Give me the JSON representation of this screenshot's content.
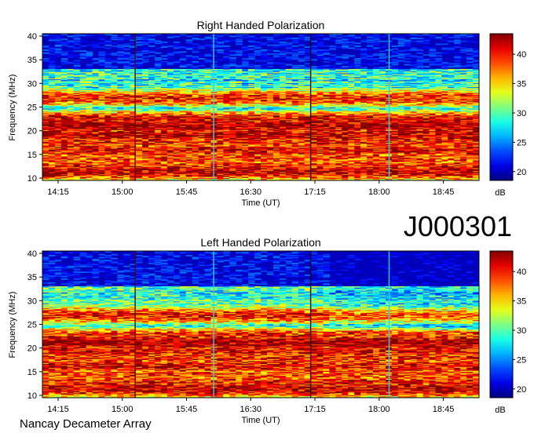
{
  "observation_id": "J000301",
  "instrument_label": "Nancay Decameter Array",
  "chart_data": [
    {
      "type": "heatmap",
      "title": "Right Handed Polarization",
      "xlabel": "Time (UT)",
      "ylabel": "Frequency (MHz)",
      "x_ticks": [
        "14:15",
        "15:00",
        "15:45",
        "16:30",
        "17:15",
        "18:00",
        "18:45"
      ],
      "x_range": [
        "14:04",
        "19:10"
      ],
      "y_ticks": [
        10,
        15,
        20,
        25,
        30,
        35,
        40
      ],
      "ylim": [
        9.5,
        40.5
      ],
      "colorbar": {
        "label": "dB",
        "ticks": [
          20,
          25,
          30,
          35,
          40
        ],
        "range": [
          18.5,
          43.5
        ],
        "colormap": "jet"
      },
      "vertical_lines": [
        {
          "time": "15:09",
          "color": "#5a0000"
        },
        {
          "time": "16:04",
          "color": "#2ad0ff"
        },
        {
          "time": "17:12",
          "color": "#1a0010"
        },
        {
          "time": "18:07",
          "color": "#2ad0ff"
        }
      ],
      "bright_bands_mhz": [
        {
          "freq": 11.5,
          "level": 42
        },
        {
          "freq": 12.6,
          "level": 40
        },
        {
          "freq": 14.2,
          "level": 39
        },
        {
          "freq": 16.0,
          "level": 41
        },
        {
          "freq": 17.8,
          "level": 40
        },
        {
          "freq": 19.2,
          "level": 42
        },
        {
          "freq": 21.2,
          "level": 43
        },
        {
          "freq": 22.5,
          "level": 41
        },
        {
          "freq": 27.0,
          "level": 40
        }
      ]
    },
    {
      "type": "heatmap",
      "title": "Left Handed Polarization",
      "xlabel": "Time (UT)",
      "ylabel": "Frequency (MHz)",
      "x_ticks": [
        "14:15",
        "15:00",
        "15:45",
        "16:30",
        "17:15",
        "18:00",
        "18:45"
      ],
      "x_range": [
        "14:04",
        "19:10"
      ],
      "y_ticks": [
        10,
        15,
        20,
        25,
        30,
        35,
        40
      ],
      "ylim": [
        9.5,
        40.5
      ],
      "colorbar": {
        "label": "dB",
        "ticks": [
          20,
          25,
          30,
          35,
          40
        ],
        "range": [
          18.5,
          43.5
        ],
        "colormap": "jet"
      },
      "vertical_lines": [
        {
          "time": "15:09",
          "color": "#5a0000"
        },
        {
          "time": "16:04",
          "color": "#2ad0ff"
        },
        {
          "time": "17:12",
          "color": "#1a0010"
        },
        {
          "time": "18:07",
          "color": "#2ad0ff"
        }
      ],
      "bright_bands_mhz": [
        {
          "freq": 11.5,
          "level": 42
        },
        {
          "freq": 12.8,
          "level": 40
        },
        {
          "freq": 14.5,
          "level": 39
        },
        {
          "freq": 16.3,
          "level": 41
        },
        {
          "freq": 18.0,
          "level": 40
        },
        {
          "freq": 19.5,
          "level": 41
        },
        {
          "freq": 21.2,
          "level": 43
        },
        {
          "freq": 22.6,
          "level": 40
        },
        {
          "freq": 27.0,
          "level": 40
        }
      ]
    }
  ]
}
